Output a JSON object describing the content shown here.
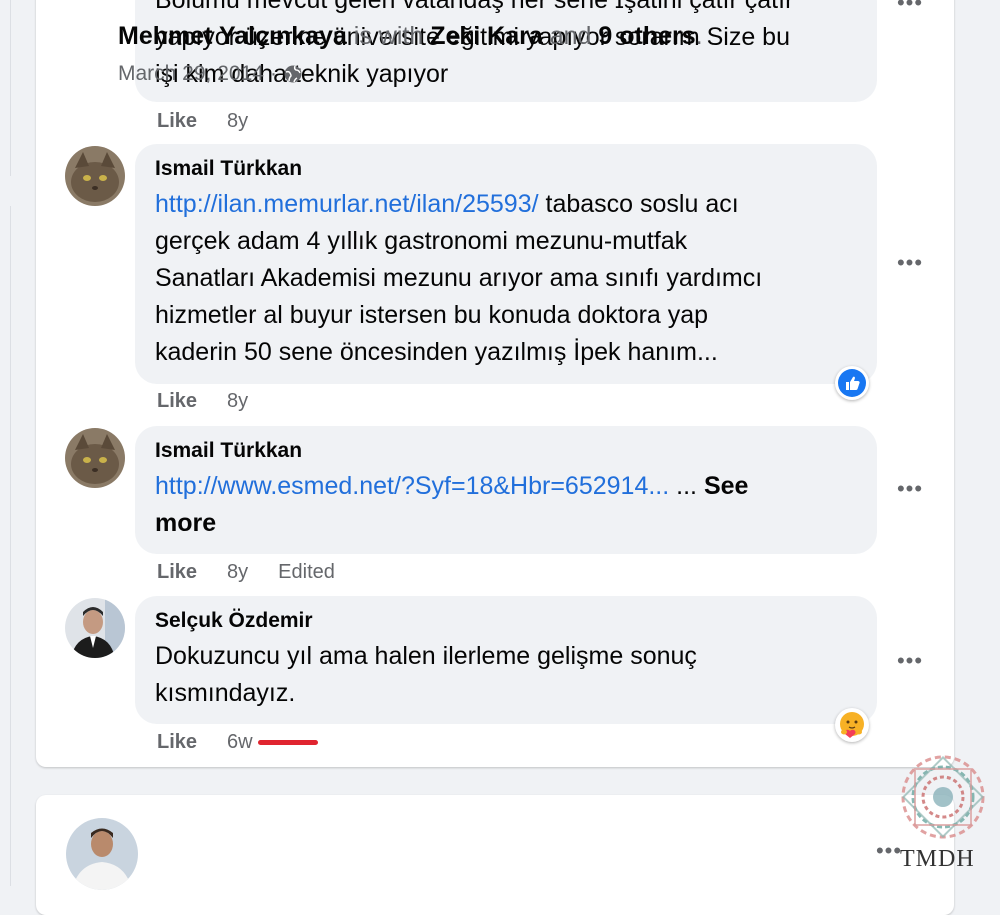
{
  "comments": [
    {
      "text_lines": [
        "Bölümü mevcut gelen vatandaş her sene ɪşatini çatır çatır",
        "yapıyor üzerine üniversite eğitimi yapıyor sorarım Size bu",
        "işi kim daha teknik yapıyor"
      ],
      "like_label": "Like",
      "time": "8y"
    },
    {
      "author": "Ismail Türkkan",
      "link": "http://ilan.memurlar.net/ilan/25593/",
      "text_first": " tabasco soslu acı",
      "text_lines": [
        "gerçek adam 4 yıllık gastronomi mezunu-mutfak",
        "Sanatları Akademisi mezunu arıyor ama sınıfı yardımcı",
        "hizmetler al buyur istersen bu konuda doktora yap",
        "kaderin 50 sene öncesinden yazılmış İpek hanım..."
      ],
      "like_label": "Like",
      "time": "8y",
      "reaction": "like-reaction-icon"
    },
    {
      "author": "Ismail Türkkan",
      "link": "http://www.esmed.net/?Syf=18&Hbr=652914...",
      "ellipsis": " ... ",
      "see": "See",
      "more": "more",
      "like_label": "Like",
      "time": "8y",
      "edited": "Edited"
    },
    {
      "author": "Selçuk Özdemir",
      "text_lines": [
        "Dokuzuncu yıl ama halen ilerleme gelişme sonuç",
        "kısmındayız."
      ],
      "like_label": "Like",
      "time": "6w",
      "reaction": "care-reaction-icon"
    }
  ],
  "post": {
    "author": "Mehmet Yalçınkaya",
    "with_text": " is with ",
    "tagged": "Zeki Kara",
    "and_text": " and ",
    "others": "9 others",
    "period": ".",
    "date": "March 29, 2014",
    "dot": "·"
  },
  "watermark": "TMDH",
  "colors": {
    "link": "#216fdb",
    "bubble": "#f0f2f5",
    "like_blue": "#1877f2",
    "underline": "#e0242f"
  }
}
